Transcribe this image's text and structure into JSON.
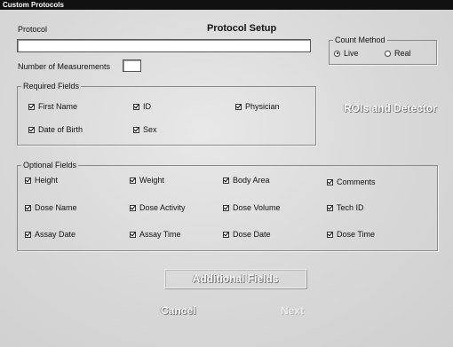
{
  "window": {
    "title": "Custom Protocols"
  },
  "header": {
    "protocol_label": "Protocol",
    "setup_title": "Protocol Setup",
    "protocol_value": ""
  },
  "count_method": {
    "label": "Count Method",
    "options": [
      {
        "label": "Live",
        "selected": true
      },
      {
        "label": "Real",
        "selected": false
      }
    ]
  },
  "measurements": {
    "label": "Number of Measurements",
    "value": ""
  },
  "required": {
    "label": "Required Fields",
    "items": [
      {
        "label": "First Name",
        "checked": true
      },
      {
        "label": "ID",
        "checked": true
      },
      {
        "label": "Physician",
        "checked": true
      },
      {
        "label": "Date of Birth",
        "checked": true
      },
      {
        "label": "Sex",
        "checked": true
      }
    ]
  },
  "rois_button": "ROIs and Detector",
  "optional": {
    "label": "Optional Fields",
    "items": [
      {
        "label": "Height",
        "checked": true
      },
      {
        "label": "Weight",
        "checked": true
      },
      {
        "label": "Body Area",
        "checked": true
      },
      {
        "label": "Comments",
        "checked": true
      },
      {
        "label": "Dose Name",
        "checked": true
      },
      {
        "label": "Dose Activity",
        "checked": true
      },
      {
        "label": "Dose Volume",
        "checked": true
      },
      {
        "label": "Tech ID",
        "checked": true
      },
      {
        "label": "Assay Date",
        "checked": true
      },
      {
        "label": "Assay Time",
        "checked": true
      },
      {
        "label": "Dose Date",
        "checked": true
      },
      {
        "label": "Dose Time",
        "checked": true
      }
    ]
  },
  "buttons": {
    "additional": "Additional Fields",
    "cancel": "Cancel",
    "next": "Next"
  }
}
